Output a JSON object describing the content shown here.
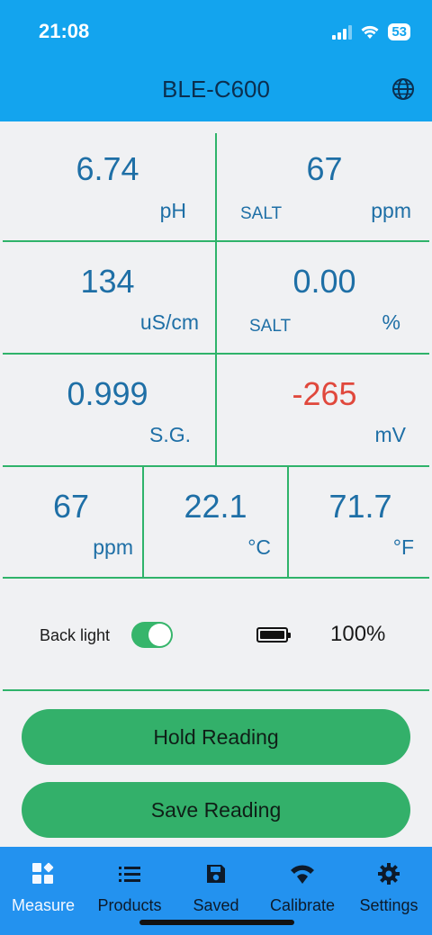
{
  "status_bar": {
    "time": "21:08",
    "battery_level": "53"
  },
  "header": {
    "title": "BLE-C600",
    "icon": "globe-icon"
  },
  "readings": {
    "ph": {
      "value": "6.74",
      "unit": "pH"
    },
    "salt_ppm": {
      "value": "67",
      "label": "SALT",
      "unit": "ppm"
    },
    "conductivity": {
      "value": "134",
      "unit": "uS/cm"
    },
    "salt_pct": {
      "value": "0.00",
      "label": "SALT",
      "unit": "%"
    },
    "sg": {
      "value": "0.999",
      "unit": "S.G."
    },
    "orp": {
      "value": "-265",
      "unit": "mV",
      "color": "#e0483c"
    },
    "tds": {
      "value": "67",
      "unit": "ppm"
    },
    "temp_c": {
      "value": "22.1",
      "unit": "°C"
    },
    "temp_f": {
      "value": "71.7",
      "unit": "°F"
    }
  },
  "controls": {
    "backlight_label": "Back light",
    "backlight_on": true,
    "battery_percent": "100%"
  },
  "buttons": {
    "hold": "Hold Reading",
    "save": "Save Reading"
  },
  "tabs": [
    {
      "label": "Measure",
      "icon": "measure-icon",
      "active": true
    },
    {
      "label": "Products",
      "icon": "list-icon"
    },
    {
      "label": "Saved",
      "icon": "save-icon"
    },
    {
      "label": "Calibrate",
      "icon": "calibrate-icon"
    },
    {
      "label": "Settings",
      "icon": "gear-icon"
    }
  ],
  "colors": {
    "header": "#13a4ee",
    "accent": "#33b06a",
    "value": "#1e6fa6",
    "tab_bar": "#2392ef"
  }
}
